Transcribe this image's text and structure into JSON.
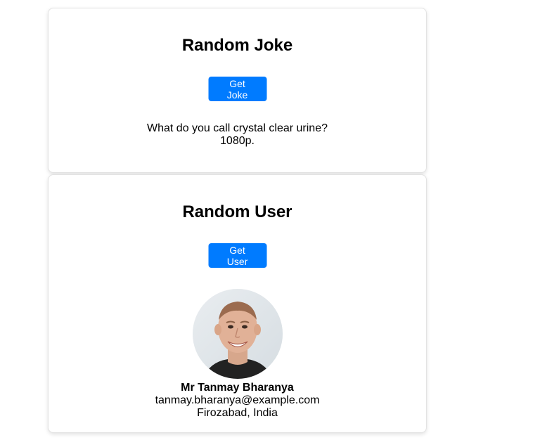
{
  "joke_card": {
    "title": "Random Joke",
    "button_label": "Get Joke",
    "setup": "What do you call crystal clear urine?",
    "punchline": "1080p."
  },
  "user_card": {
    "title": "Random User",
    "button_label": "Get User",
    "avatar_icon": "user-photo",
    "name": "Mr Tanmay Bharanya",
    "email": "tanmay.bharanya@example.com",
    "location": "Firozabad, India"
  },
  "colors": {
    "button_bg": "#007bff",
    "button_text": "#ffffff"
  }
}
